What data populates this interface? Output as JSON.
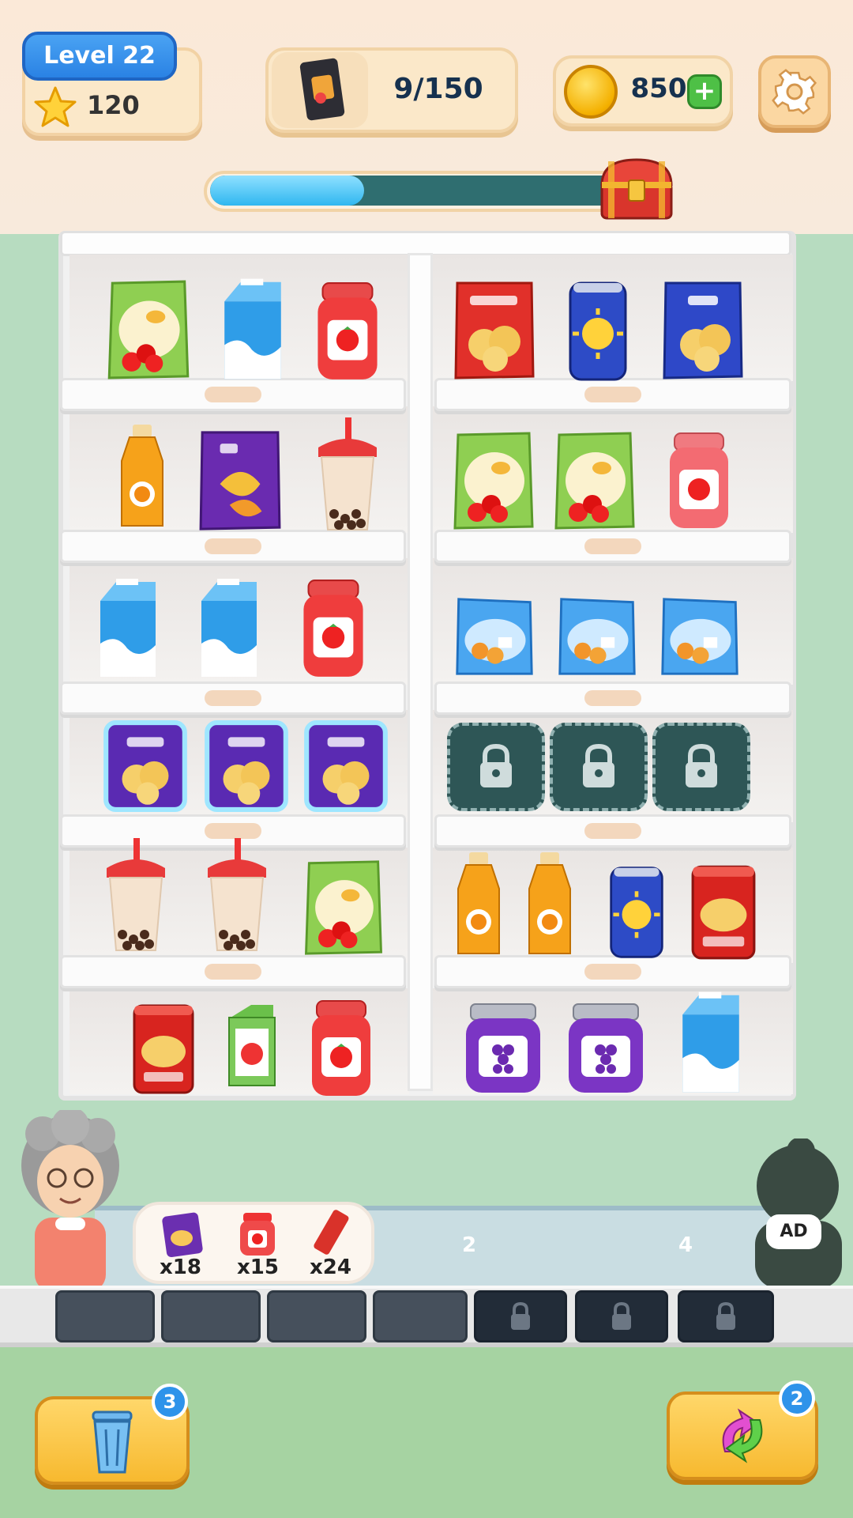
{
  "hud": {
    "level_label": "Level 22",
    "stars": "120",
    "goal_progress": "9/150",
    "coins": "850",
    "coin_plus": "+",
    "level_progress": 0.37
  },
  "tray": {
    "counts": [
      "x18",
      "x15",
      "x24"
    ],
    "queue_numbers": [
      "2",
      "4"
    ],
    "ad_label": "AD"
  },
  "boosters": {
    "trash_count": "3",
    "swap_count": "2"
  },
  "colors": {
    "accent_blue": "#2a82e4",
    "gold": "#f7b92f",
    "locked_slot": "#2e5656"
  }
}
